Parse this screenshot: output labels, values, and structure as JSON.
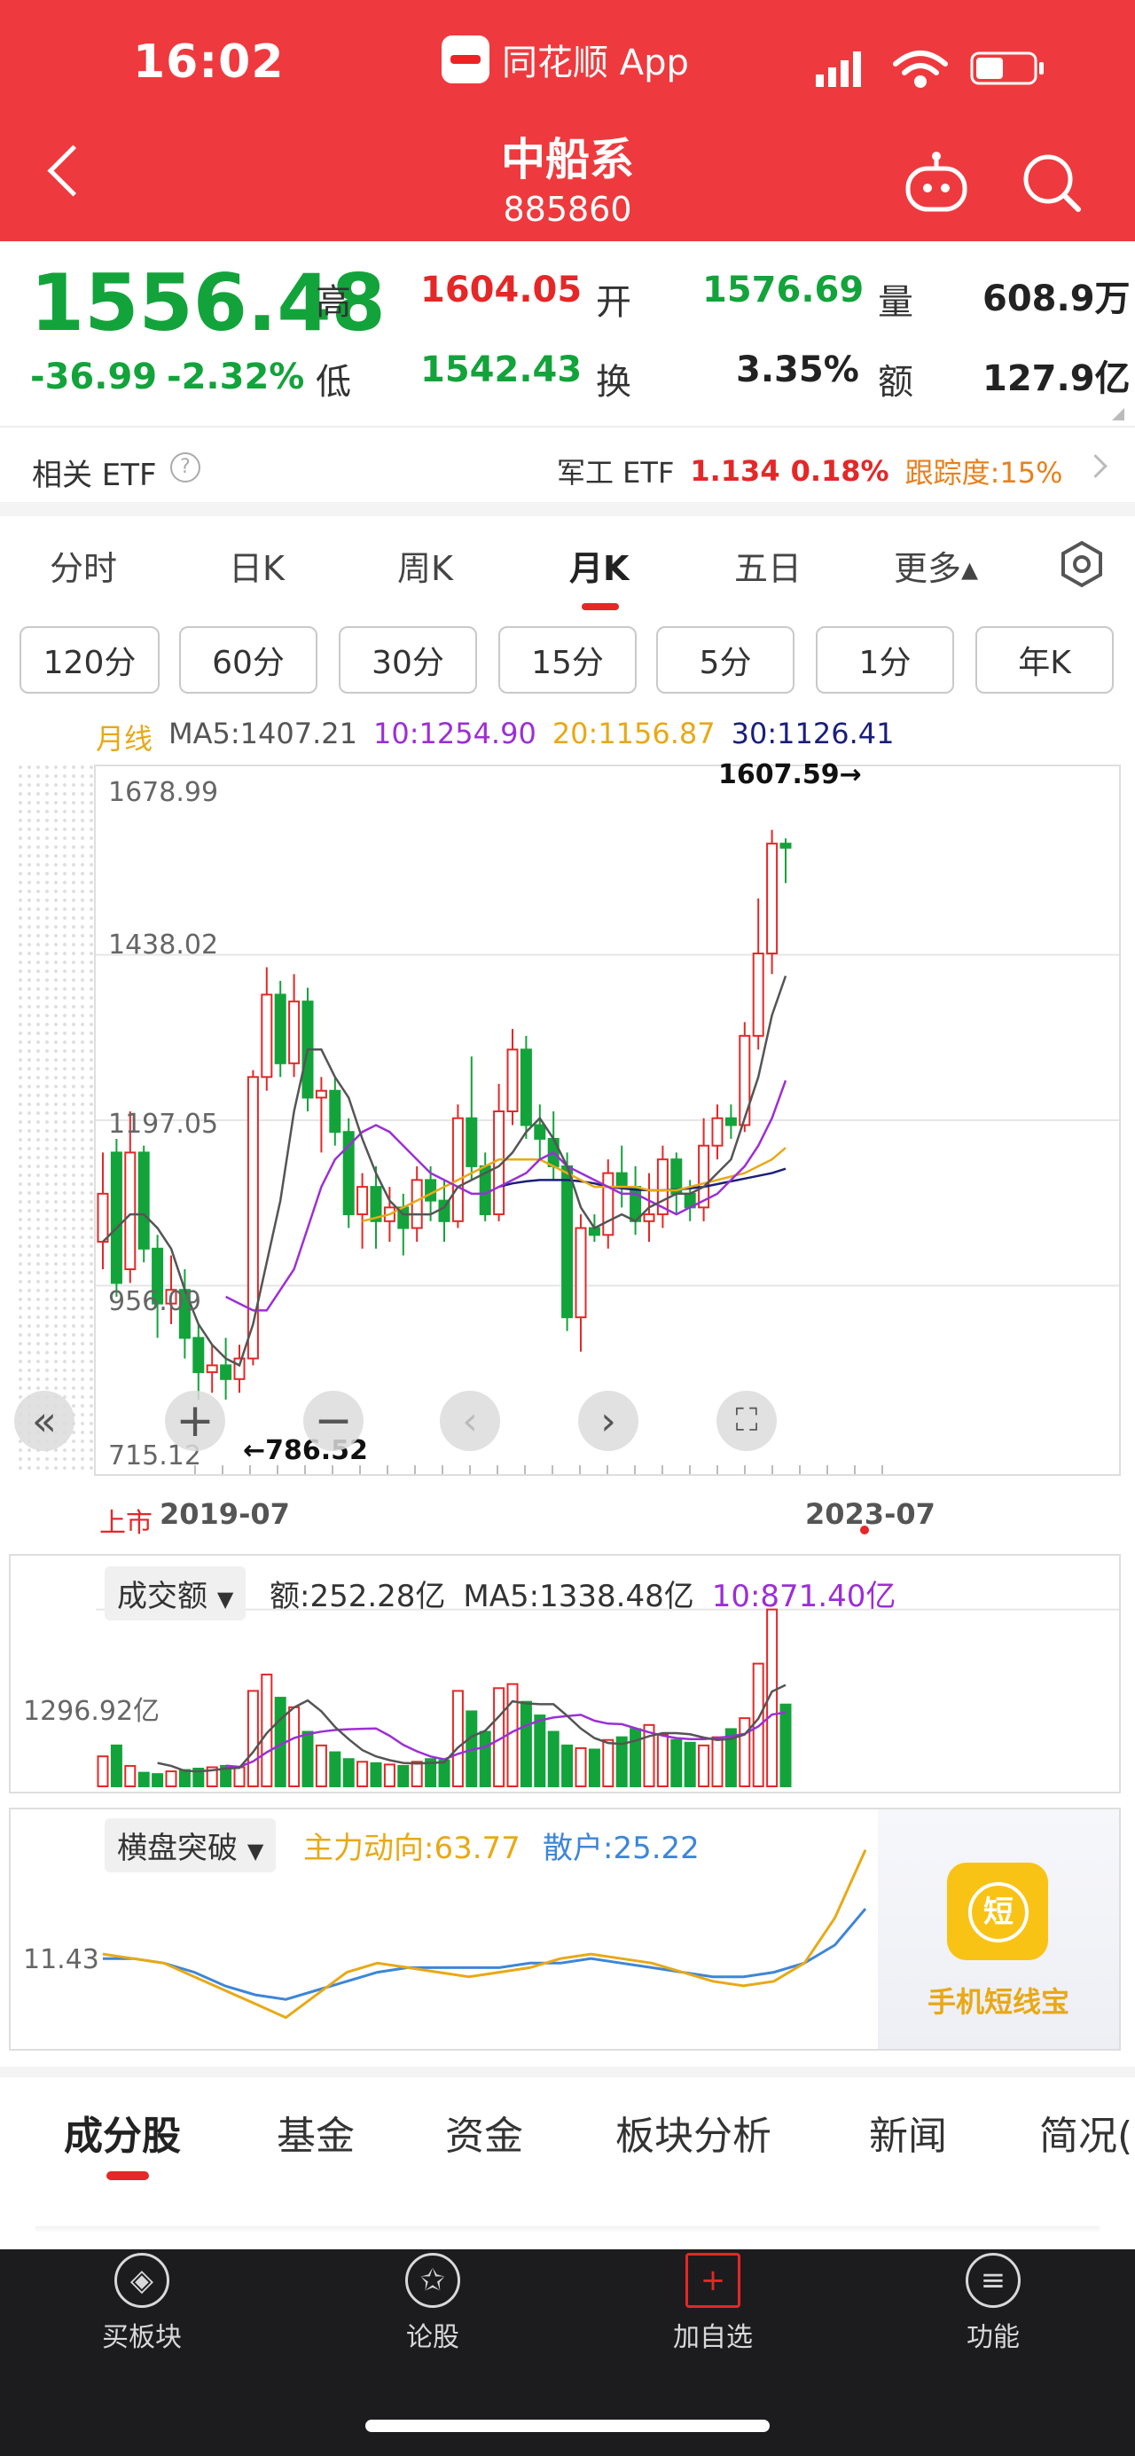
{
  "status": {
    "time": "16:02",
    "source_app": "同花顺 App"
  },
  "header": {
    "title": "中船系",
    "code": "885860"
  },
  "quote": {
    "price": "1556.48",
    "change": "-36.99",
    "change_pct": "-2.32%",
    "high_label": "高",
    "high": "1604.05",
    "open_label": "开",
    "open": "1576.69",
    "vol_label": "量",
    "vol": "608.9万",
    "low_label": "低",
    "low": "1542.43",
    "turnover_label": "换",
    "turnover": "3.35%",
    "amount_label": "额",
    "amount": "127.9亿"
  },
  "etf": {
    "label": "相关 ETF",
    "name": "军工 ETF",
    "price": "1.134",
    "pct": "0.18%",
    "tracking": "跟踪度:15%"
  },
  "ktabs": [
    "分时",
    "日K",
    "周K",
    "月K",
    "五日",
    "更多▴"
  ],
  "periods": [
    "120分",
    "60分",
    "30分",
    "15分",
    "5分",
    "1分",
    "年K"
  ],
  "ma": {
    "label": "月线",
    "ma5": "MA5:1407.21",
    "ma10": "10:1254.90",
    "ma20": "20:1156.87",
    "ma30": "30:1126.41"
  },
  "kchart": {
    "y_labels": [
      "1678.99",
      "1438.02",
      "1197.05",
      "956.09",
      "715.12"
    ],
    "max_note": "1607.59→",
    "min_note": "←786.52",
    "x_start_tag": "上市",
    "x_start": "2019-07",
    "x_end": "2023-07"
  },
  "volume": {
    "indicator": "成交额",
    "amt": "额:252.28亿",
    "ma5": "MA5:1338.48亿",
    "ma10": "10:871.40亿",
    "y_label": "1296.92亿"
  },
  "flow": {
    "indicator": "横盘突破",
    "main": "主力动向:63.77",
    "retail": "散户:25.22",
    "y_label": "11.43",
    "promo": "手机短线宝",
    "promo_icon": "短"
  },
  "bottom_tabs": [
    "成分股",
    "基金",
    "资金",
    "板块分析",
    "新闻",
    "简况("
  ],
  "nav": [
    {
      "label": "买板块",
      "icon": "◈"
    },
    {
      "label": "论股",
      "icon": "✩"
    },
    {
      "label": "加自选",
      "icon": "+"
    },
    {
      "label": "功能",
      "icon": "≡"
    }
  ],
  "colors": {
    "up": "#e52727",
    "down": "#13a33b",
    "brand": "#ee3a3e",
    "ma5": "#555555",
    "ma10": "#9b2fd6",
    "ma20": "#e8a916",
    "ma30": "#1a1f7a",
    "flow_main": "#e8a916",
    "flow_retail": "#3d86d8"
  },
  "chart_data": {
    "type": "candlestick",
    "ylim": [
      715.12,
      1678.99
    ],
    "x_start": "2019-07",
    "x_end": "2023-07",
    "candles": [
      [
        1020,
        1090,
        1150,
        980
      ],
      [
        1150,
        960,
        1170,
        940
      ],
      [
        980,
        1150,
        1210,
        960
      ],
      [
        1150,
        1010,
        1160,
        990
      ],
      [
        1010,
        930,
        1030,
        880
      ],
      [
        930,
        950,
        1000,
        900
      ],
      [
        950,
        880,
        980,
        850
      ],
      [
        880,
        830,
        900,
        790
      ],
      [
        830,
        840,
        870,
        800
      ],
      [
        840,
        820,
        880,
        790
      ],
      [
        820,
        850,
        870,
        800
      ],
      [
        850,
        1260,
        1270,
        840
      ],
      [
        1260,
        1380,
        1420,
        1240
      ],
      [
        1380,
        1280,
        1400,
        1260
      ],
      [
        1280,
        1370,
        1410,
        1260
      ],
      [
        1370,
        1230,
        1390,
        1210
      ],
      [
        1230,
        1240,
        1260,
        1150
      ],
      [
        1240,
        1180,
        1260,
        1160
      ],
      [
        1180,
        1060,
        1200,
        1040
      ],
      [
        1060,
        1100,
        1120,
        1010
      ],
      [
        1100,
        1050,
        1130,
        1010
      ],
      [
        1050,
        1070,
        1100,
        1020
      ],
      [
        1070,
        1040,
        1090,
        1000
      ],
      [
        1040,
        1110,
        1130,
        1020
      ],
      [
        1110,
        1080,
        1130,
        1050
      ],
      [
        1080,
        1050,
        1110,
        1020
      ],
      [
        1050,
        1200,
        1220,
        1040
      ],
      [
        1200,
        1130,
        1290,
        1110
      ],
      [
        1130,
        1060,
        1150,
        1050
      ],
      [
        1060,
        1210,
        1250,
        1050
      ],
      [
        1210,
        1300,
        1330,
        1190
      ],
      [
        1300,
        1190,
        1320,
        1170
      ],
      [
        1190,
        1170,
        1220,
        1140
      ],
      [
        1170,
        1130,
        1210,
        1110
      ],
      [
        1130,
        910,
        1150,
        890
      ],
      [
        910,
        1040,
        1060,
        860
      ],
      [
        1040,
        1030,
        1060,
        1020
      ],
      [
        1030,
        1120,
        1140,
        1010
      ],
      [
        1120,
        1100,
        1160,
        1070
      ],
      [
        1100,
        1050,
        1130,
        1030
      ],
      [
        1050,
        1060,
        1120,
        1020
      ],
      [
        1060,
        1140,
        1160,
        1040
      ],
      [
        1140,
        1090,
        1150,
        1060
      ],
      [
        1090,
        1070,
        1110,
        1050
      ],
      [
        1070,
        1160,
        1200,
        1050
      ],
      [
        1160,
        1200,
        1220,
        1140
      ],
      [
        1200,
        1190,
        1220,
        1170
      ],
      [
        1190,
        1320,
        1340,
        1180
      ],
      [
        1320,
        1440,
        1520,
        1300
      ],
      [
        1440,
        1600,
        1620,
        1410
      ],
      [
        1600,
        1594,
        1607.59,
        1542.43
      ]
    ],
    "ma5": [
      1020,
      1040,
      1060,
      1060,
      1040,
      1010,
      950,
      900,
      870,
      850,
      840,
      900,
      990,
      1080,
      1210,
      1300,
      1300,
      1260,
      1230,
      1170,
      1120,
      1080,
      1060,
      1060,
      1060,
      1070,
      1100,
      1110,
      1120,
      1130,
      1150,
      1180,
      1200,
      1170,
      1130,
      1070,
      1040,
      1050,
      1060,
      1050,
      1070,
      1080,
      1090,
      1090,
      1100,
      1120,
      1140,
      1200,
      1260,
      1350,
      1407.21
    ],
    "ma10": [
      null,
      null,
      null,
      null,
      null,
      null,
      null,
      null,
      null,
      940,
      930,
      920,
      920,
      950,
      980,
      1040,
      1100,
      1140,
      1160,
      1180,
      1190,
      1180,
      1160,
      1140,
      1120,
      1110,
      1100,
      1090,
      1090,
      1100,
      1110,
      1120,
      1140,
      1150,
      1130,
      1120,
      1110,
      1100,
      1090,
      1090,
      1080,
      1070,
      1060,
      1070,
      1080,
      1090,
      1110,
      1130,
      1160,
      1200,
      1254.9
    ],
    "ma20": [
      null,
      null,
      null,
      null,
      null,
      null,
      null,
      null,
      null,
      null,
      null,
      null,
      null,
      null,
      null,
      null,
      null,
      null,
      null,
      1050,
      1055,
      1060,
      1070,
      1080,
      1090,
      1100,
      1110,
      1120,
      1130,
      1140,
      1140,
      1140,
      1140,
      1130,
      1120,
      1110,
      1100,
      1100,
      1100,
      1100,
      1095,
      1095,
      1095,
      1100,
      1105,
      1110,
      1115,
      1120,
      1130,
      1140,
      1156.87
    ],
    "ma30": [
      null,
      null,
      null,
      null,
      null,
      null,
      null,
      null,
      null,
      null,
      null,
      null,
      null,
      null,
      null,
      null,
      null,
      null,
      null,
      null,
      null,
      null,
      null,
      null,
      null,
      null,
      null,
      null,
      null,
      1100,
      1105,
      1108,
      1110,
      1110,
      1110,
      1108,
      1105,
      1100,
      1098,
      1096,
      1095,
      1095,
      1096,
      1098,
      1100,
      1104,
      1108,
      1112,
      1116,
      1120,
      1126.41
    ],
    "volume": [
      220,
      300,
      150,
      100,
      90,
      110,
      120,
      130,
      140,
      150,
      140,
      700,
      820,
      650,
      580,
      400,
      300,
      250,
      200,
      180,
      170,
      160,
      150,
      180,
      200,
      190,
      700,
      550,
      400,
      720,
      750,
      620,
      520,
      400,
      300,
      280,
      270,
      340,
      360,
      420,
      450,
      380,
      340,
      320,
      300,
      360,
      420,
      500,
      900,
      1296.92,
      600
    ],
    "flow_main": [
      12,
      11,
      10,
      7,
      4,
      1,
      -2,
      3,
      8,
      10,
      9,
      8,
      7,
      8,
      9,
      11,
      12,
      11,
      10,
      8,
      6,
      5,
      6,
      10,
      20,
      35
    ],
    "flow_retail": [
      11,
      11,
      10,
      8,
      5,
      3,
      2,
      4,
      6,
      8,
      9,
      9,
      9,
      9,
      10,
      10,
      11,
      10,
      9,
      8,
      7,
      7,
      8,
      10,
      14,
      22
    ]
  }
}
